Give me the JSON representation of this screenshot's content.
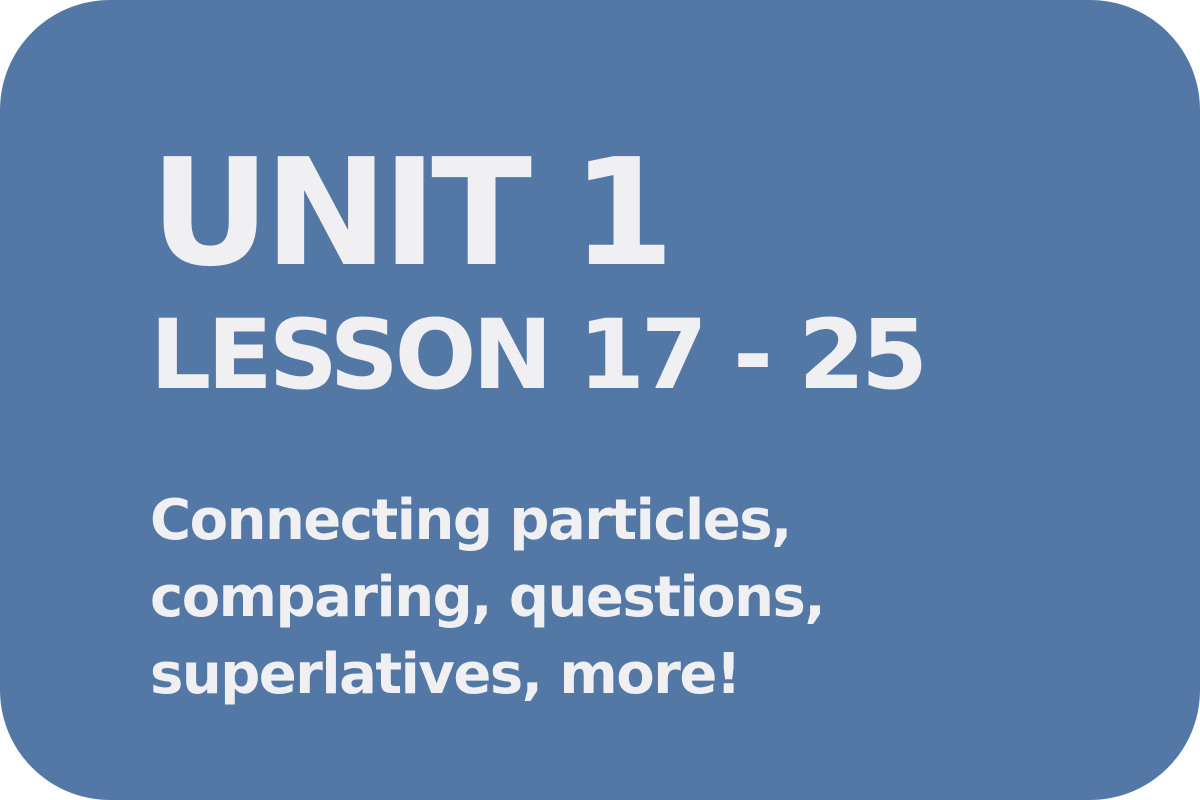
{
  "card": {
    "background_color": "#5478a5",
    "text_color": "#f0f0f2",
    "title": "UNIT 1",
    "subtitle": "LESSON 17 - 25",
    "description_lines": [
      "Connecting particles,",
      "comparing, questions,",
      "superlatives, more!"
    ]
  }
}
